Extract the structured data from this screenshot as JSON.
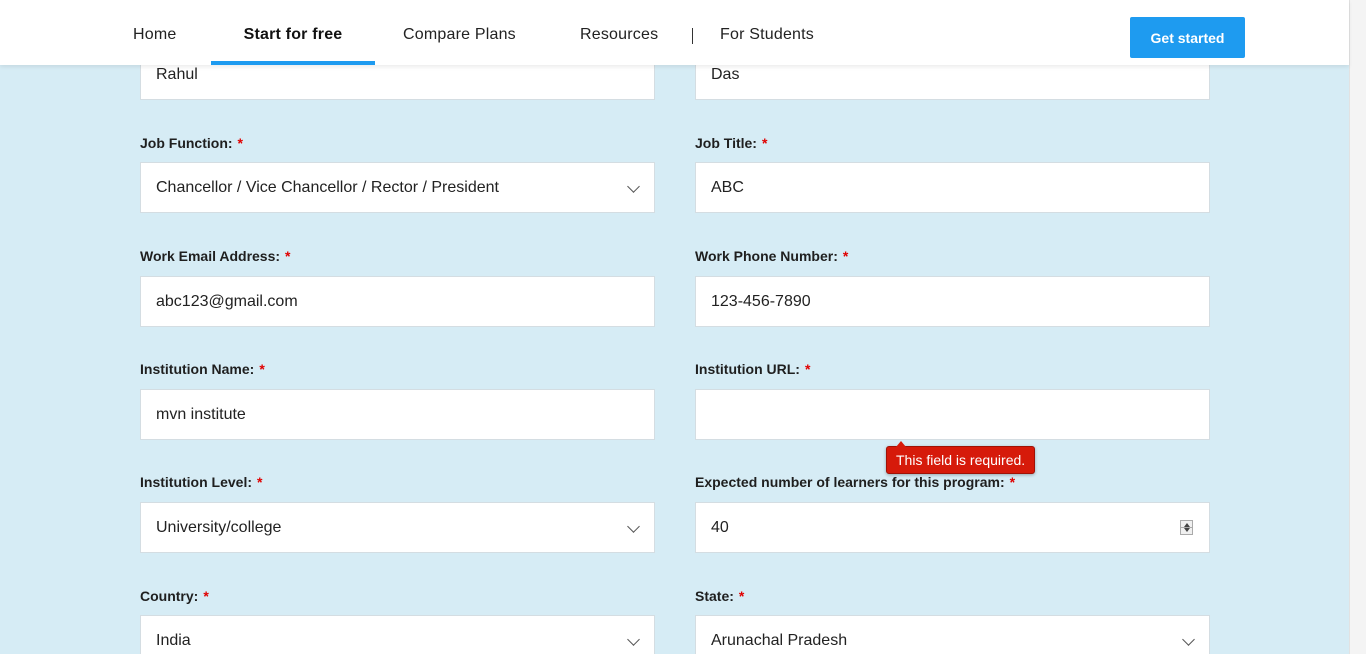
{
  "nav": {
    "home": "Home",
    "start_for_free": "Start for free",
    "compare_plans": "Compare Plans",
    "resources": "Resources",
    "separator": "|",
    "for_students": "For Students",
    "get_started": "Get started",
    "accent_color": "#1e9bf0"
  },
  "form": {
    "required_mark": "*",
    "first_name": {
      "value": "Rahul"
    },
    "last_name": {
      "value": "Das"
    },
    "job_function": {
      "label": "Job Function:",
      "value": "Chancellor / Vice Chancellor / Rector / President"
    },
    "job_title": {
      "label": "Job Title:",
      "value": "ABC"
    },
    "work_email": {
      "label": "Work Email Address:",
      "value": "abc123@gmail.com"
    },
    "work_phone": {
      "label": "Work Phone Number:",
      "value": "123-456-7890"
    },
    "institution_name": {
      "label": "Institution Name:",
      "value": "mvn institute"
    },
    "institution_url": {
      "label": "Institution URL:",
      "value": ""
    },
    "institution_level": {
      "label": "Institution Level:",
      "value": "University/college"
    },
    "expected_learners": {
      "label": "Expected number of learners for this program:",
      "value": "40"
    },
    "country": {
      "label": "Country:",
      "value": "India"
    },
    "state": {
      "label": "State:",
      "value": "Arunachal Pradesh"
    }
  },
  "validation": {
    "message": "This field is required.",
    "color": "#d61a0a"
  },
  "colors": {
    "background": "#d6ecf5",
    "required": "#e00000"
  }
}
